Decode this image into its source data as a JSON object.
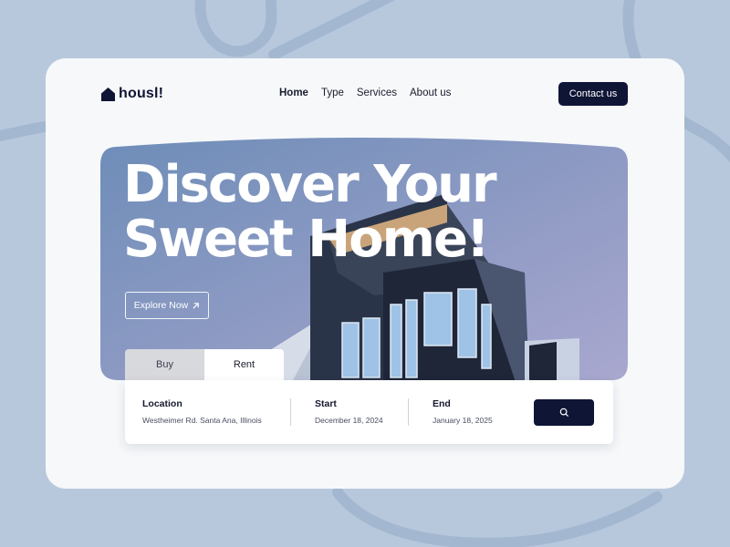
{
  "brand": {
    "name": "housl!",
    "icon": "house-icon",
    "color": "#0f1535"
  },
  "nav": {
    "items": [
      {
        "label": "Home",
        "active": true
      },
      {
        "label": "Type",
        "active": false
      },
      {
        "label": "Services",
        "active": false
      },
      {
        "label": "About us",
        "active": false
      }
    ]
  },
  "header": {
    "contact_label": "Contact us"
  },
  "hero": {
    "title_line1": "Discover Your",
    "title_line2": "Sweet Home!",
    "explore_label": "Explore Now",
    "explore_icon": "arrow-up-right-icon",
    "image": "modern-building-photo"
  },
  "search": {
    "tabs": [
      {
        "label": "Buy",
        "active": false
      },
      {
        "label": "Rent",
        "active": true
      }
    ],
    "fields": [
      {
        "label": "Location",
        "value": "Westheimer Rd. Santa Ana, Illinois"
      },
      {
        "label": "Start",
        "value": "December 18, 2024"
      },
      {
        "label": "End",
        "value": "January 18, 2025"
      }
    ],
    "button_icon": "search-icon"
  },
  "colors": {
    "background": "#b8c8dc",
    "card": "#f6f8fa",
    "accent": "#0f1535"
  }
}
